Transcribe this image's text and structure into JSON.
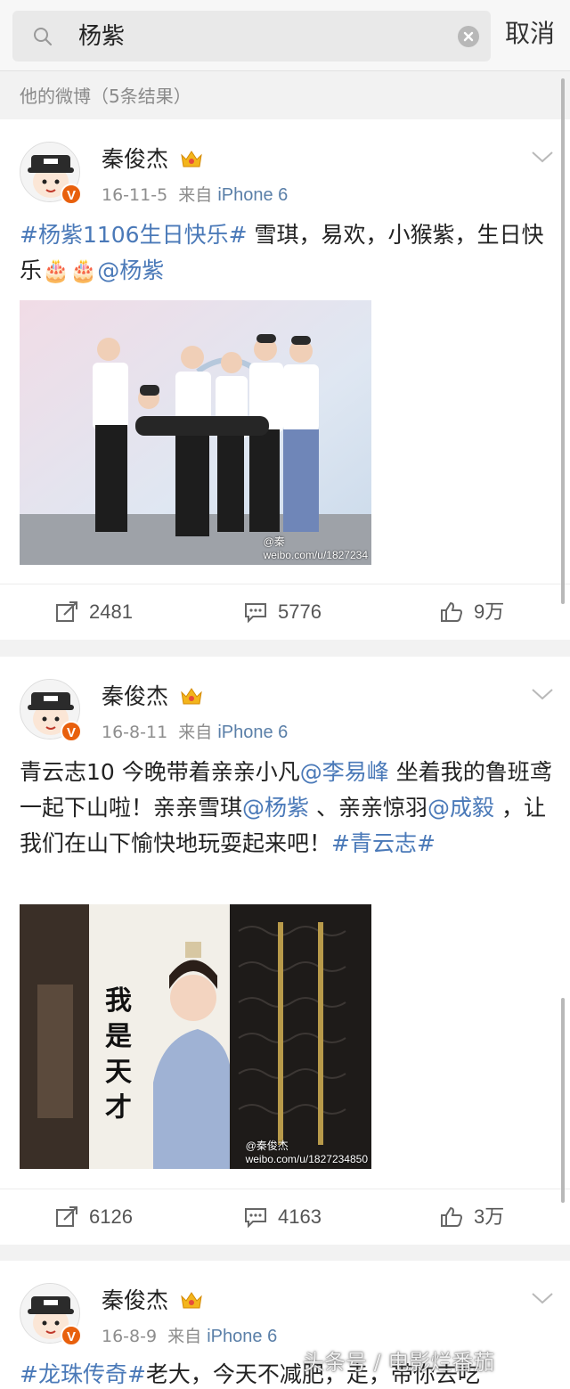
{
  "search": {
    "query": "杨紫",
    "cancel_label": "取消"
  },
  "section": {
    "title": "他的微博（5条结果）"
  },
  "colors": {
    "link": "#4a79b8",
    "vip_badge": "#e8600d",
    "meta_grey": "#8d8d8d"
  },
  "posts": [
    {
      "user": "秦俊杰",
      "date": "16-11-5",
      "via": "来自",
      "source": "iPhone 6",
      "text_parts": [
        {
          "type": "tag",
          "text": "#杨紫1106生日快乐#"
        },
        {
          "type": "text",
          "text": " 雪琪，易欢，小猴紫，生日快乐🎂🎂"
        },
        {
          "type": "mention",
          "text": "@杨紫"
        }
      ],
      "image_watermark": "weibo.com/u/1827234",
      "image_watermark_name": "@秦",
      "reposts": "2481",
      "comments": "5776",
      "likes": "9万"
    },
    {
      "user": "秦俊杰",
      "date": "16-8-11",
      "via": "来自",
      "source": "iPhone 6",
      "text_parts": [
        {
          "type": "text",
          "text": "青云志10 今晚带着亲亲小凡"
        },
        {
          "type": "mention",
          "text": "@李易峰"
        },
        {
          "type": "text",
          "text": " 坐着我的鲁班鸢一起下山啦！亲亲雪琪"
        },
        {
          "type": "mention",
          "text": "@杨紫"
        },
        {
          "type": "text",
          "text": " 、亲亲惊羽"
        },
        {
          "type": "mention",
          "text": "@成毅"
        },
        {
          "type": "text",
          "text": " ，让我们在山下愉快地玩耍起来吧！"
        },
        {
          "type": "tag",
          "text": "#青云志#"
        }
      ],
      "image_caption": "我是天才",
      "image_watermark": "weibo.com/u/1827234850",
      "image_watermark_name": "@秦俊杰",
      "reposts": "6126",
      "comments": "4163",
      "likes": "3万"
    },
    {
      "user": "秦俊杰",
      "date": "16-8-9",
      "via": "来自",
      "source": "iPhone 6",
      "text_parts": [
        {
          "type": "tag",
          "text": "#龙珠传奇#"
        },
        {
          "type": "text",
          "text": "老大，今天不减肥，走，带你去吃"
        }
      ]
    }
  ],
  "overlay_watermark": "头条号 / 电影烂番茄",
  "icons": {
    "search": "search-icon",
    "clear": "clear-icon",
    "crown": "vip-crown-icon",
    "chevron": "chevron-down-icon",
    "repost": "repost-icon",
    "comment": "comment-icon",
    "like": "thumbs-up-icon"
  }
}
